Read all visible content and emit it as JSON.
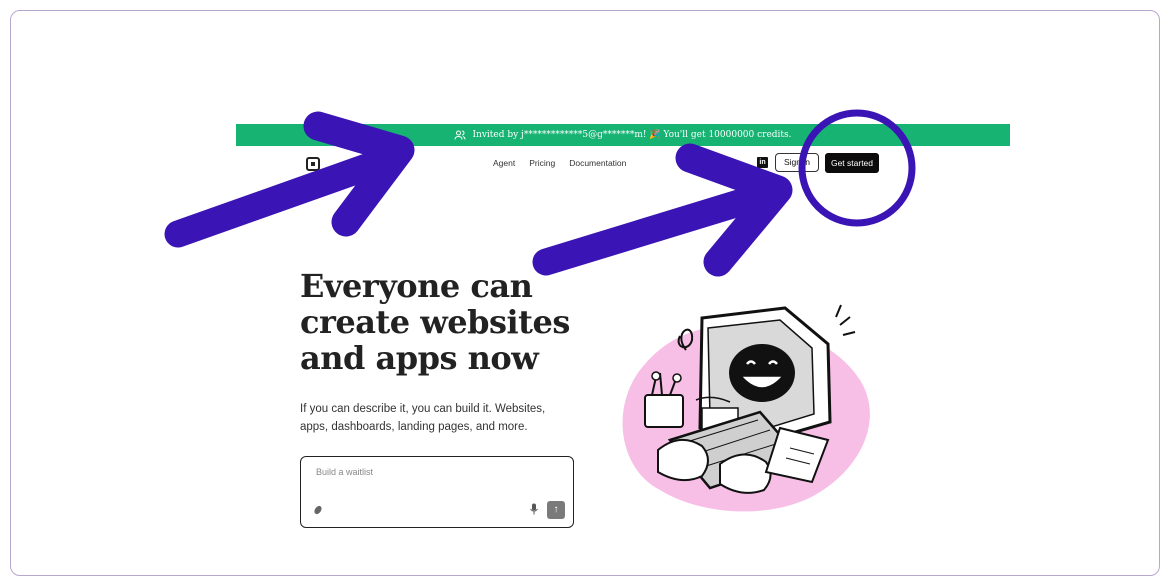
{
  "banner": {
    "text": "Invited by j*************5@g*******m! 🎉 You'll get 10000000 credits.",
    "icon": "users-icon",
    "color": "#17b373"
  },
  "nav": {
    "logo_icon": "logo-icon",
    "links": [
      "Agent",
      "Pricing",
      "Documentation"
    ],
    "linkedin_label": "in",
    "signin_label": "Sign in",
    "get_started_label": "Get started"
  },
  "hero": {
    "title_lines": [
      "Everyone can",
      "create websites",
      "and apps now"
    ],
    "subtitle_lines": [
      "If you can describe it, you can build it. Websites,",
      "apps, dashboards, landing pages, and more."
    ]
  },
  "prompt": {
    "placeholder": "Build a waitlist",
    "value": "",
    "attach_icon": "paperclip-icon",
    "mic_icon": "microphone-icon",
    "send_icon": "arrow-up-icon",
    "send_label": "↑"
  },
  "annotations": {
    "color": "#3a14b4",
    "items": [
      "arrow",
      "arrow",
      "circle"
    ]
  }
}
